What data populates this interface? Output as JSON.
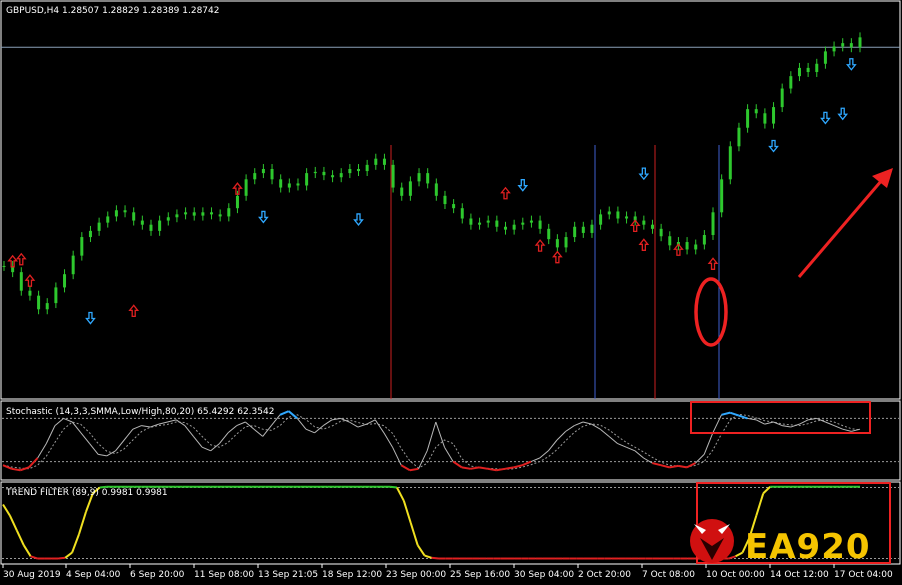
{
  "main_chart": {
    "title": "GBPUSD,H4  1.28507 1.28829 1.28389 1.28742",
    "ylim": [
      1.2,
      1.295
    ],
    "candles": [
      1.232,
      1.2305,
      1.226,
      1.2248,
      1.2215,
      1.223,
      1.2268,
      1.23,
      1.2345,
      1.239,
      1.2405,
      1.2425,
      1.244,
      1.2455,
      1.245,
      1.243,
      1.242,
      1.2405,
      1.243,
      1.2438,
      1.2445,
      1.245,
      1.2442,
      1.245,
      1.2445,
      1.244,
      1.246,
      1.249,
      1.253,
      1.2545,
      1.2555,
      1.253,
      1.251,
      1.252,
      1.2515,
      1.2545,
      1.2548,
      1.254,
      1.2535,
      1.2545,
      1.2555,
      1.255,
      1.2565,
      1.258,
      1.2565,
      1.251,
      1.249,
      1.2525,
      1.2545,
      1.252,
      1.249,
      1.247,
      1.246,
      1.2435,
      1.242,
      1.2425,
      1.243,
      1.2415,
      1.2408,
      1.242,
      1.2425,
      1.243,
      1.241,
      1.2385,
      1.2365,
      1.239,
      1.2415,
      1.24,
      1.242,
      1.2445,
      1.2452,
      1.2435,
      1.244,
      1.243,
      1.242,
      1.241,
      1.2392,
      1.237,
      1.2378,
      1.236,
      1.2372,
      1.2395,
      1.245,
      1.253,
      1.261,
      1.2655,
      1.27,
      1.269,
      1.2665,
      1.2705,
      1.275,
      1.278,
      1.28,
      1.279,
      1.281,
      1.284,
      1.2852,
      1.286,
      1.285,
      1.2874
    ],
    "buy_arrows": [
      [
        10,
        1.2195
      ],
      [
        30,
        1.244
      ],
      [
        41,
        1.2434
      ],
      [
        60,
        1.2517
      ],
      [
        74,
        1.2545
      ],
      [
        89,
        1.2612
      ],
      [
        95,
        1.268
      ],
      [
        97,
        1.269
      ],
      [
        98,
        1.281
      ]
    ],
    "sell_arrows": [
      [
        1,
        1.233
      ],
      [
        2,
        1.2335
      ],
      [
        3,
        1.2283
      ],
      [
        15,
        1.221
      ],
      [
        27,
        1.2506
      ],
      [
        58,
        1.2495
      ],
      [
        62,
        1.2368
      ],
      [
        64,
        1.234
      ],
      [
        73,
        1.2416
      ],
      [
        74,
        1.237
      ],
      [
        78,
        1.2358
      ],
      [
        82,
        1.2324
      ]
    ],
    "vlines": [
      {
        "x": 391,
        "color": "#cc2020"
      },
      {
        "x": 595,
        "color": "#3f5fd0"
      },
      {
        "x": 655,
        "color": "#cc2020"
      },
      {
        "x": 719,
        "color": "#3f5fd0"
      }
    ],
    "hline_price": 1.285,
    "colors": {
      "bull": "#2ec82e",
      "wick": "#2ec82e",
      "buy": "#2fa8ff",
      "sell": "#e02020",
      "annot": "#ee2222"
    }
  },
  "stochastic": {
    "label": "Stochastic (14,3,3,SMMA,Low/High,80,20) 65.4292 62.3542",
    "main": [
      15,
      10,
      8,
      12,
      25,
      45,
      70,
      80,
      75,
      60,
      45,
      30,
      28,
      35,
      50,
      65,
      70,
      68,
      72,
      75,
      78,
      70,
      55,
      40,
      35,
      45,
      60,
      70,
      75,
      65,
      55,
      70,
      85,
      90,
      80,
      65,
      60,
      70,
      78,
      80,
      75,
      68,
      72,
      78,
      60,
      40,
      15,
      8,
      10,
      35,
      75,
      40,
      20,
      12,
      10,
      12,
      10,
      8,
      10,
      12,
      15,
      20,
      25,
      35,
      50,
      62,
      70,
      75,
      72,
      65,
      55,
      45,
      40,
      35,
      25,
      18,
      15,
      12,
      14,
      12,
      18,
      30,
      60,
      85,
      88,
      84,
      80,
      78,
      72,
      75,
      70,
      68,
      72,
      78,
      80,
      75,
      70,
      65,
      62,
      65
    ],
    "levels": [
      80,
      20
    ]
  },
  "trend_filter": {
    "label": "TREND FILTER (89,9) 0.9981 0.9981",
    "values": [
      0.75,
      0.6,
      0.4,
      0.2,
      0.05,
      0.02,
      0.02,
      0.02,
      0.02,
      0.03,
      0.1,
      0.35,
      0.65,
      0.9,
      0.98,
      0.99,
      0.99,
      0.99,
      0.99,
      0.99,
      0.99,
      0.99,
      0.99,
      0.99,
      0.99,
      0.99,
      0.99,
      0.99,
      0.99,
      0.99,
      0.99,
      0.99,
      0.99,
      0.99,
      0.99,
      0.99,
      0.99,
      0.99,
      0.99,
      0.99,
      0.99,
      0.99,
      0.99,
      0.99,
      0.99,
      0.99,
      0.99,
      0.99,
      0.99,
      0.99,
      0.99,
      0.99,
      0.99,
      0.99,
      0.99,
      0.99,
      0.99,
      0.98,
      0.8,
      0.5,
      0.2,
      0.06,
      0.03,
      0.02,
      0.02,
      0.02,
      0.02,
      0.02,
      0.02,
      0.02,
      0.02,
      0.02,
      0.02,
      0.02,
      0.02,
      0.02,
      0.02,
      0.02,
      0.02,
      0.02,
      0.02,
      0.02,
      0.02,
      0.02,
      0.02,
      0.02,
      0.02,
      0.02,
      0.02,
      0.02,
      0.02,
      0.02,
      0.02,
      0.02,
      0.02,
      0.02,
      0.02,
      0.02,
      0.02,
      0.02,
      0.02,
      0.02,
      0.02,
      0.02,
      0.02,
      0.02,
      0.05,
      0.1,
      0.3,
      0.6,
      0.9,
      0.99,
      0.99,
      0.99,
      0.99,
      0.99,
      0.99,
      0.99,
      0.99,
      0.99,
      0.99,
      0.99,
      0.99,
      0.99,
      0.99
    ],
    "levels_price": [
      0.98,
      0.02
    ]
  },
  "time_axis": [
    "30 Aug 2019",
    "4 Sep 04:00",
    "6 Sep 20:00",
    "11 Sep 08:00",
    "13 Sep 21:05",
    "18 Sep 12:00",
    "23 Sep 00:00",
    "25 Sep 16:00",
    "30 Sep 04:00",
    "2 Oct 20:00",
    "7 Oct 08:00",
    "10 Oct 00:00",
    "14 Oct 12:00",
    "17 Oct 04:00"
  ],
  "brand": {
    "text": "EA920",
    "color": "#f5c400"
  }
}
